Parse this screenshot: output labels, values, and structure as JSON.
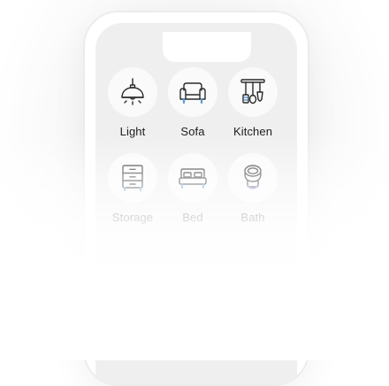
{
  "categories": [
    {
      "label": "Light",
      "icon": "pendant-lamp-icon"
    },
    {
      "label": "Sofa",
      "icon": "sofa-icon"
    },
    {
      "label": "Kitchen",
      "icon": "kitchen-utensils-icon"
    },
    {
      "label": "Storage",
      "icon": "drawer-cabinet-icon"
    },
    {
      "label": "Bed",
      "icon": "bed-icon"
    },
    {
      "label": "Bath",
      "icon": "toilet-icon"
    }
  ],
  "colors": {
    "accent_blue": "#5b9bd5",
    "accent_purple": "#8e7cc3",
    "icon_stroke": "#2b2b2b"
  }
}
